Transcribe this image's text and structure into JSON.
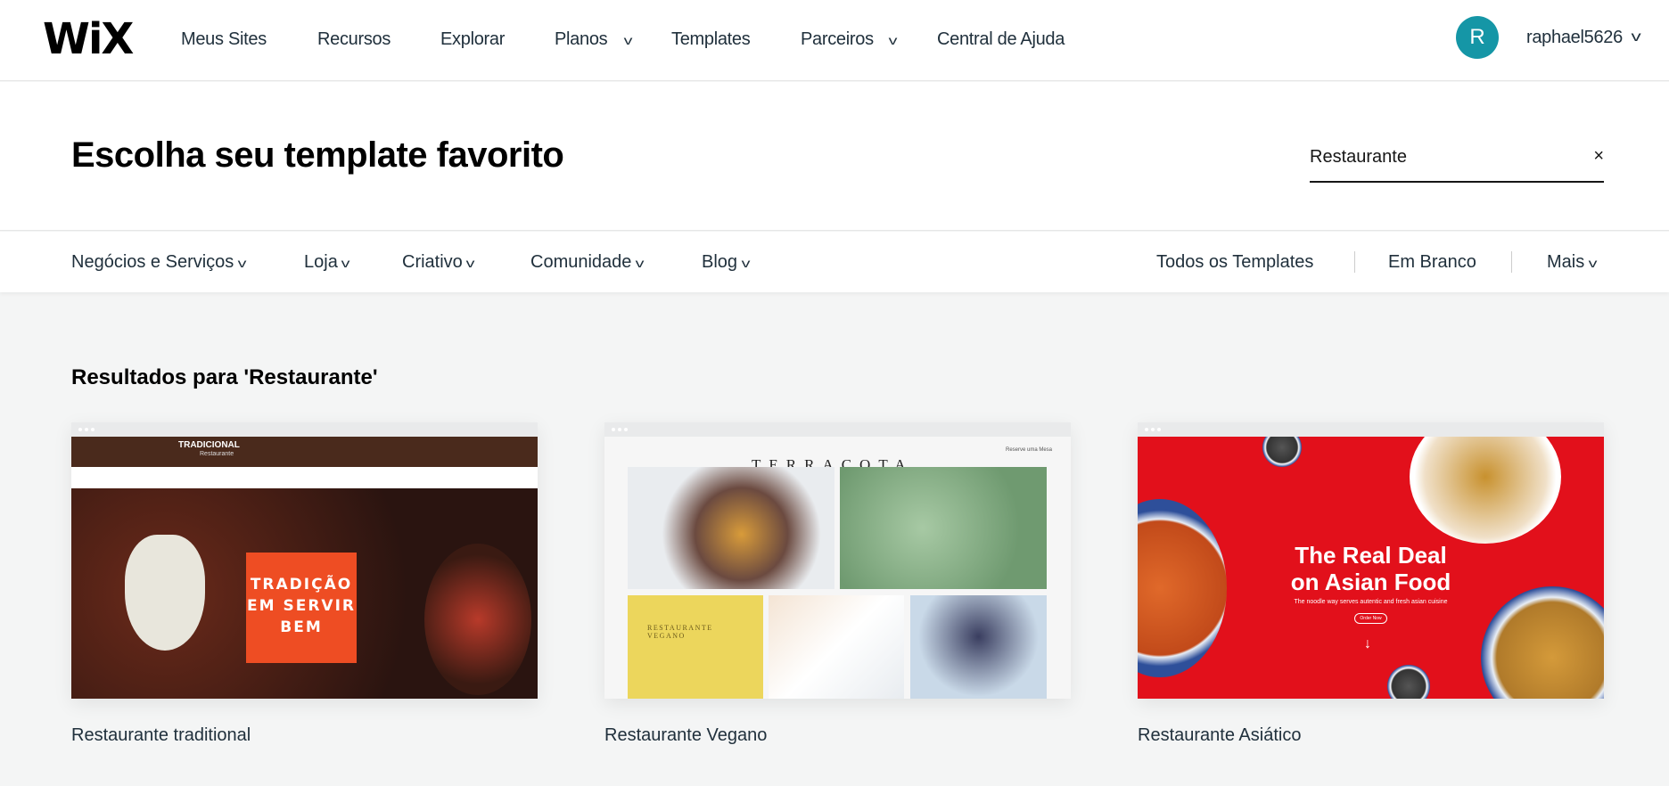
{
  "header": {
    "logo": "WiX",
    "nav": [
      {
        "label": "Meus Sites"
      },
      {
        "label": "Recursos"
      },
      {
        "label": "Explorar"
      },
      {
        "label": "Planos",
        "dropdown": true
      },
      {
        "label": "Templates"
      },
      {
        "label": "Parceiros",
        "dropdown": true
      },
      {
        "label": "Central de Ajuda"
      }
    ],
    "avatar_initial": "R",
    "username": "raphael5626",
    "avatar_color": "#1596a6"
  },
  "hero": {
    "title": "Escolha seu template favorito",
    "search_value": "Restaurante",
    "clear_icon": "×"
  },
  "categories": {
    "left": [
      {
        "label": "Negócios e Serviços"
      },
      {
        "label": "Loja"
      },
      {
        "label": "Criativo"
      },
      {
        "label": "Comunidade"
      },
      {
        "label": "Blog"
      }
    ],
    "right": [
      {
        "label": "Todos os Templates"
      },
      {
        "label": "Em Branco"
      },
      {
        "label": "Mais"
      }
    ]
  },
  "results": {
    "heading": "Resultados para 'Restaurante'",
    "cards": [
      {
        "name": "Restaurante traditional",
        "thumb": {
          "brand": "TRADICIONAL",
          "brand_sub": "Restaurante",
          "headline": "TRADIÇÃO EM SERVIR BEM"
        }
      },
      {
        "name": "Restaurante Vegano",
        "thumb": {
          "brand": "TERRACOTA",
          "box_title": "RESTAURANTE VEGANO",
          "reserve": "Reserve uma Mesa"
        }
      },
      {
        "name": "Restaurante Asiático",
        "thumb": {
          "headline1": "The Real Deal",
          "headline2": "on Asian Food",
          "sub": "The noodle way serves autentic and fresh asian cuisine",
          "cta": "Order Now"
        }
      }
    ]
  }
}
